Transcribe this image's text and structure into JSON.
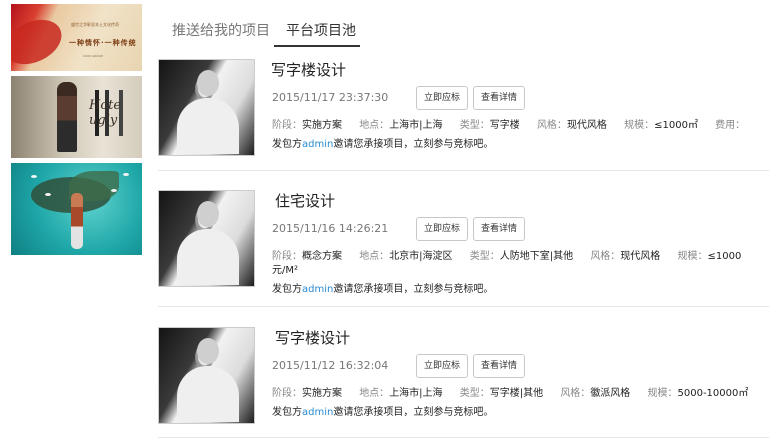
{
  "banners": [
    {
      "lines": [
        "盛世之华彰显本土文化传奇",
        "一种情怀·一种传统",
        "XXXX GROUP"
      ]
    },
    {
      "script": "Hote ugly"
    },
    {}
  ],
  "tabs": [
    {
      "label": "推送给我的项目",
      "active": false
    },
    {
      "label": "平台项目池",
      "active": true
    }
  ],
  "projects": [
    {
      "title": "写字楼设计",
      "date": "2015/11/17 23:37:30",
      "bid_label": "立即应标",
      "detail_label": "查看详情",
      "stage_label": "阶段：",
      "stage": "实施方案",
      "location_label": "地点：",
      "location": "上海市|上海",
      "type_label": "类型：",
      "type": "写字楼",
      "style_label": "风格：",
      "style": "现代风格",
      "scale_label": "规模：",
      "scale": "≤1000㎡",
      "fee_label": "费用：",
      "scale_cont": "",
      "invite_prefix": "发包方",
      "invite_user": "admin",
      "invite_suffix": "邀请您承接项目，立刻参与竞标吧。"
    },
    {
      "title": "住宅设计",
      "date": "2015/11/16 14:26:21",
      "bid_label": "立即应标",
      "detail_label": "查看详情",
      "stage_label": "阶段：",
      "stage": "概念方案",
      "location_label": "地点：",
      "location": "北京市|海淀区",
      "type_label": "类型：",
      "type": "人防地下室|其他",
      "style_label": "风格：",
      "style": "现代风格",
      "scale_label": "规模：",
      "scale": "≤1000",
      "fee_label": "",
      "scale_cont": "元/M²",
      "invite_prefix": "发包方",
      "invite_user": "admin",
      "invite_suffix": "邀请您承接项目，立刻参与竞标吧。"
    },
    {
      "title": "写字楼设计",
      "date": "2015/11/12 16:32:04",
      "bid_label": "立即应标",
      "detail_label": "查看详情",
      "stage_label": "阶段：",
      "stage": "实施方案",
      "location_label": "地点：",
      "location": "上海市|上海",
      "type_label": "类型：",
      "type": "写字楼|其他",
      "style_label": "风格：",
      "style": "徽派风格",
      "scale_label": "规模：",
      "scale": "5000-10000㎡",
      "fee_label": "",
      "scale_cont": "",
      "invite_prefix": "发包方",
      "invite_user": "admin",
      "invite_suffix": "邀请您承接项目，立刻参与竞标吧。"
    }
  ]
}
